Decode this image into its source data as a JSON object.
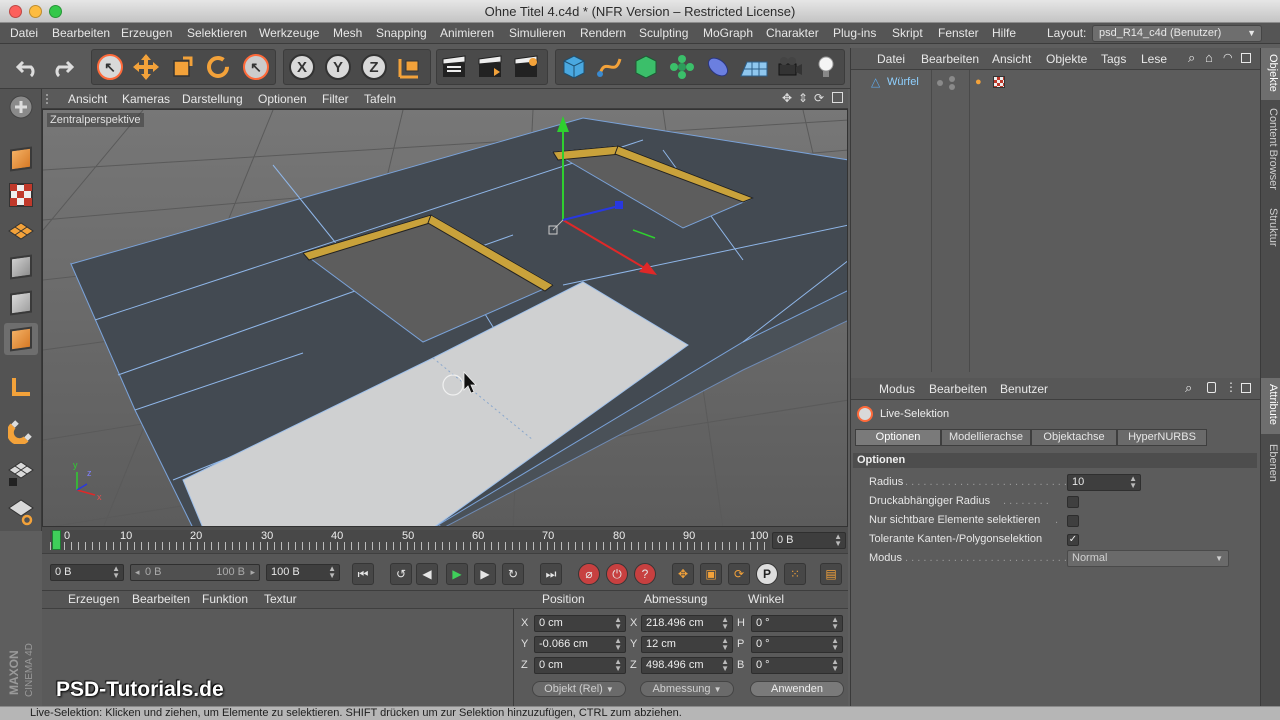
{
  "window": {
    "title": "Ohne Titel 4.c4d * (NFR Version – Restricted License)"
  },
  "menubar": {
    "items": [
      "Datei",
      "Bearbeiten",
      "Erzeugen",
      "Selektieren",
      "Werkzeuge",
      "Mesh",
      "Snapping",
      "Animieren",
      "Simulieren",
      "Rendern",
      "Sculpting",
      "MoGraph",
      "Charakter",
      "Plug-ins",
      "Skript",
      "Fenster",
      "Hilfe"
    ],
    "layout_label": "Layout:",
    "layout_value": "psd_R14_c4d (Benutzer)"
  },
  "toolbar": {
    "axis_x": "X",
    "axis_y": "Y",
    "axis_z": "Z"
  },
  "viewport": {
    "menu": [
      "Ansicht",
      "Kameras",
      "Darstellung",
      "Optionen",
      "Filter",
      "Tafeln"
    ],
    "label": "Zentralperspektive",
    "axis_y": "y",
    "axis_z": "z",
    "axis_x": "x"
  },
  "timeline": {
    "ticks": [
      "0",
      "10",
      "20",
      "30",
      "40",
      "50",
      "60",
      "70",
      "80",
      "90",
      "100"
    ],
    "current_frame": "0 B"
  },
  "transport": {
    "start": "0 B",
    "range_start": "0 B",
    "range_end": "100 B",
    "end": "100 B"
  },
  "material_manager": {
    "menu": [
      "Erzeugen",
      "Bearbeiten",
      "Funktion",
      "Textur"
    ]
  },
  "coordinates": {
    "headers": {
      "position": "Position",
      "size": "Abmessung",
      "rotation": "Winkel"
    },
    "rows": [
      {
        "axis": "X",
        "pos": "0 cm",
        "size_axis": "X",
        "size": "218.496 cm",
        "rot_axis": "H",
        "rot": "0 °"
      },
      {
        "axis": "Y",
        "pos": "-0.066 cm",
        "size_axis": "Y",
        "size": "12 cm",
        "rot_axis": "P",
        "rot": "0 °"
      },
      {
        "axis": "Z",
        "pos": "0 cm",
        "size_axis": "Z",
        "size": "498.496 cm",
        "rot_axis": "B",
        "rot": "0 °"
      }
    ],
    "mode": "Objekt (Rel)",
    "size_mode": "Abmessung",
    "apply": "Anwenden"
  },
  "object_manager": {
    "menu": [
      "Datei",
      "Bearbeiten",
      "Ansicht",
      "Objekte",
      "Tags",
      "Lese"
    ],
    "objects": [
      {
        "name": "Würfel"
      }
    ]
  },
  "attribute_manager": {
    "menu": [
      "Modus",
      "Bearbeiten",
      "Benutzer"
    ],
    "tool_name": "Live-Selektion",
    "tabs": [
      "Optionen",
      "Modellierachse",
      "Objektachse",
      "HyperNURBS"
    ],
    "section": "Optionen",
    "rows": [
      {
        "label": "Radius",
        "value": "10"
      },
      {
        "label": "Druckabhängiger Radius",
        "checked": false
      },
      {
        "label": "Nur sichtbare Elemente selektieren",
        "checked": false
      },
      {
        "label": "Tolerante Kanten-/Polygonselektion",
        "checked": true,
        "mark": "✓"
      },
      {
        "label": "Modus",
        "value": "Normal"
      }
    ]
  },
  "right_tabs": [
    "Objekte",
    "Content Browser",
    "Struktur",
    "Attribute",
    "Ebenen"
  ],
  "branding": {
    "watermark": "PSD-Tutorials.de",
    "vendor": "MAXON",
    "product": "CINEMA 4D"
  },
  "status": {
    "text": "Live-Selektion: Klicken und ziehen, um Elemente zu selektieren. SHIFT drücken um zur Selektion hinzuzufügen, CTRL zum abziehen."
  },
  "colors": {
    "accent_orange": "#f39a2e",
    "selection_circle": "#ff6a3a",
    "playhead": "#3fcf5a"
  }
}
